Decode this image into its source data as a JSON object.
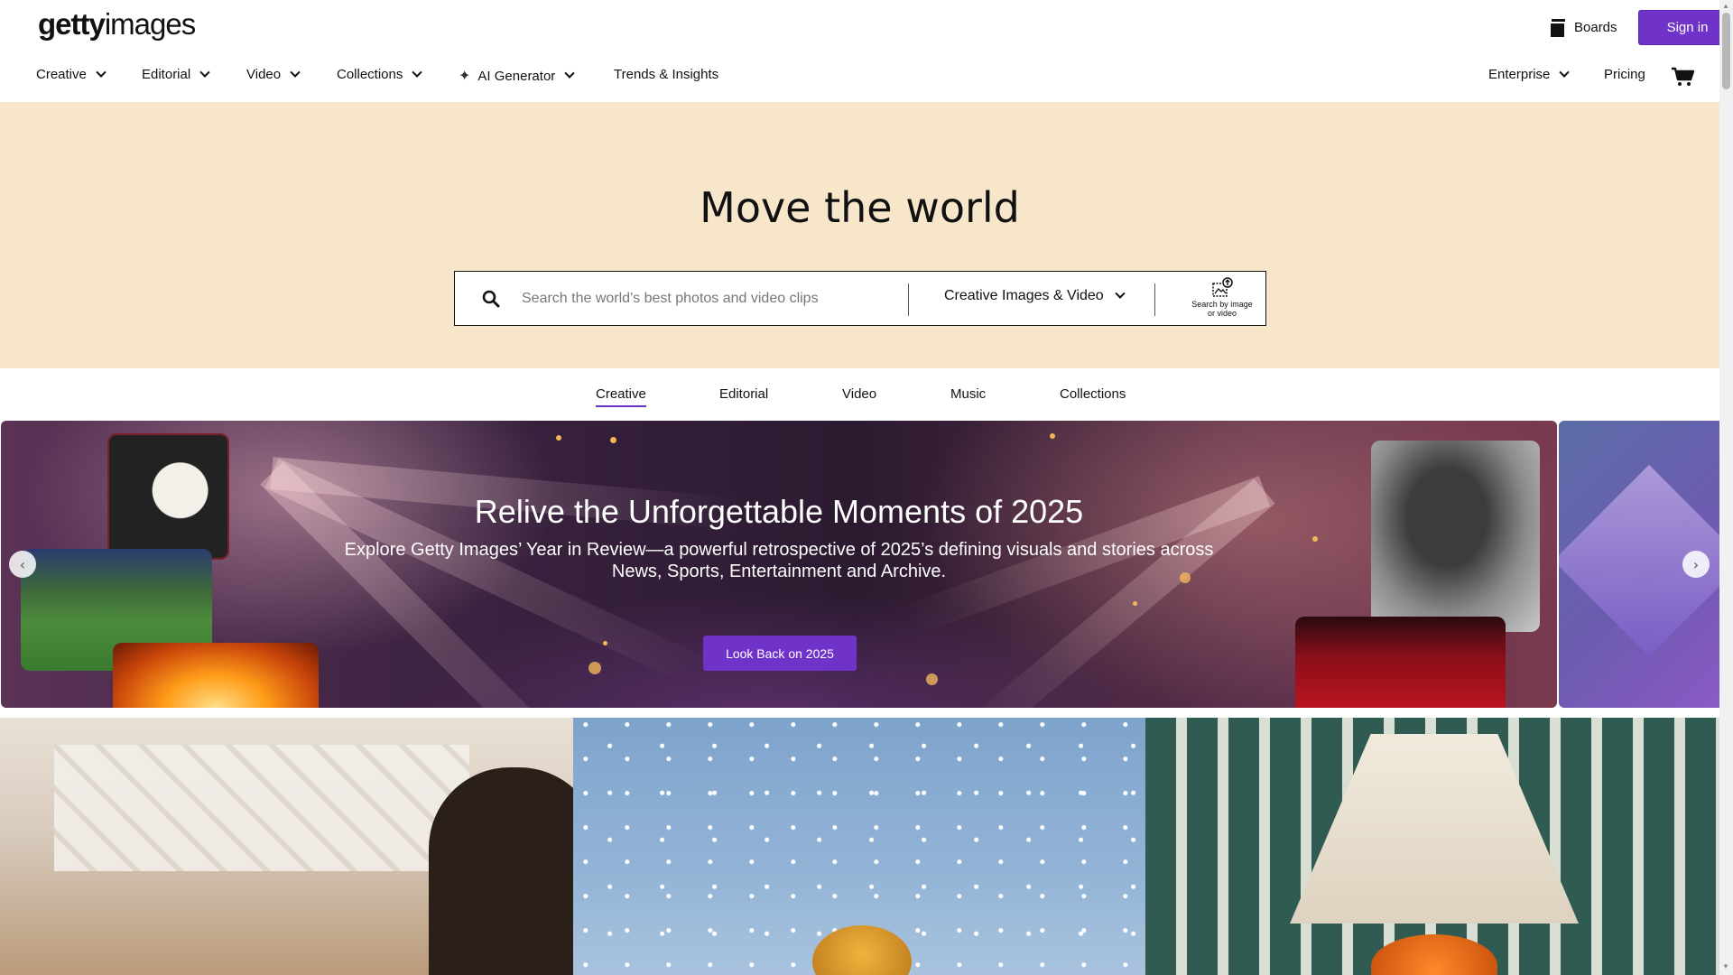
{
  "header": {
    "logo_bold": "getty",
    "logo_light": "images",
    "boards_label": "Boards",
    "signin_label": "Sign in"
  },
  "nav": {
    "items": [
      {
        "label": "Creative"
      },
      {
        "label": "Editorial"
      },
      {
        "label": "Video"
      },
      {
        "label": "Collections"
      },
      {
        "label": "AI Generator"
      },
      {
        "label": "Trends & Insights"
      }
    ],
    "enterprise_label": "Enterprise",
    "pricing_label": "Pricing"
  },
  "hero": {
    "title": "Move the world",
    "search_placeholder": "Search the world's best photos and video clips",
    "scope_label": "Creative Images & Video",
    "search_by_image_line1": "Search by image",
    "search_by_image_line2": "or video"
  },
  "tabs": [
    {
      "label": "Creative",
      "active": true
    },
    {
      "label": "Editorial"
    },
    {
      "label": "Video"
    },
    {
      "label": "Music"
    },
    {
      "label": "Collections"
    }
  ],
  "banner": {
    "title": "Relive the Unforgettable Moments of 2025",
    "subtitle": "Explore Getty Images’ Year in Review—a powerful retrospective of 2025’s defining visuals and stories across News, Sports, Entertainment and Archive.",
    "cta_label": "Look Back on 2025",
    "prev_glyph": "‹",
    "next_glyph": "›"
  },
  "colors": {
    "accent": "#6f33c9",
    "hero_bg": "#f8e6cb"
  },
  "icons": [
    "boards-icon",
    "cart-icon",
    "search-icon",
    "search-by-image-icon",
    "sparkle-icon",
    "chevron-down-icon"
  ]
}
